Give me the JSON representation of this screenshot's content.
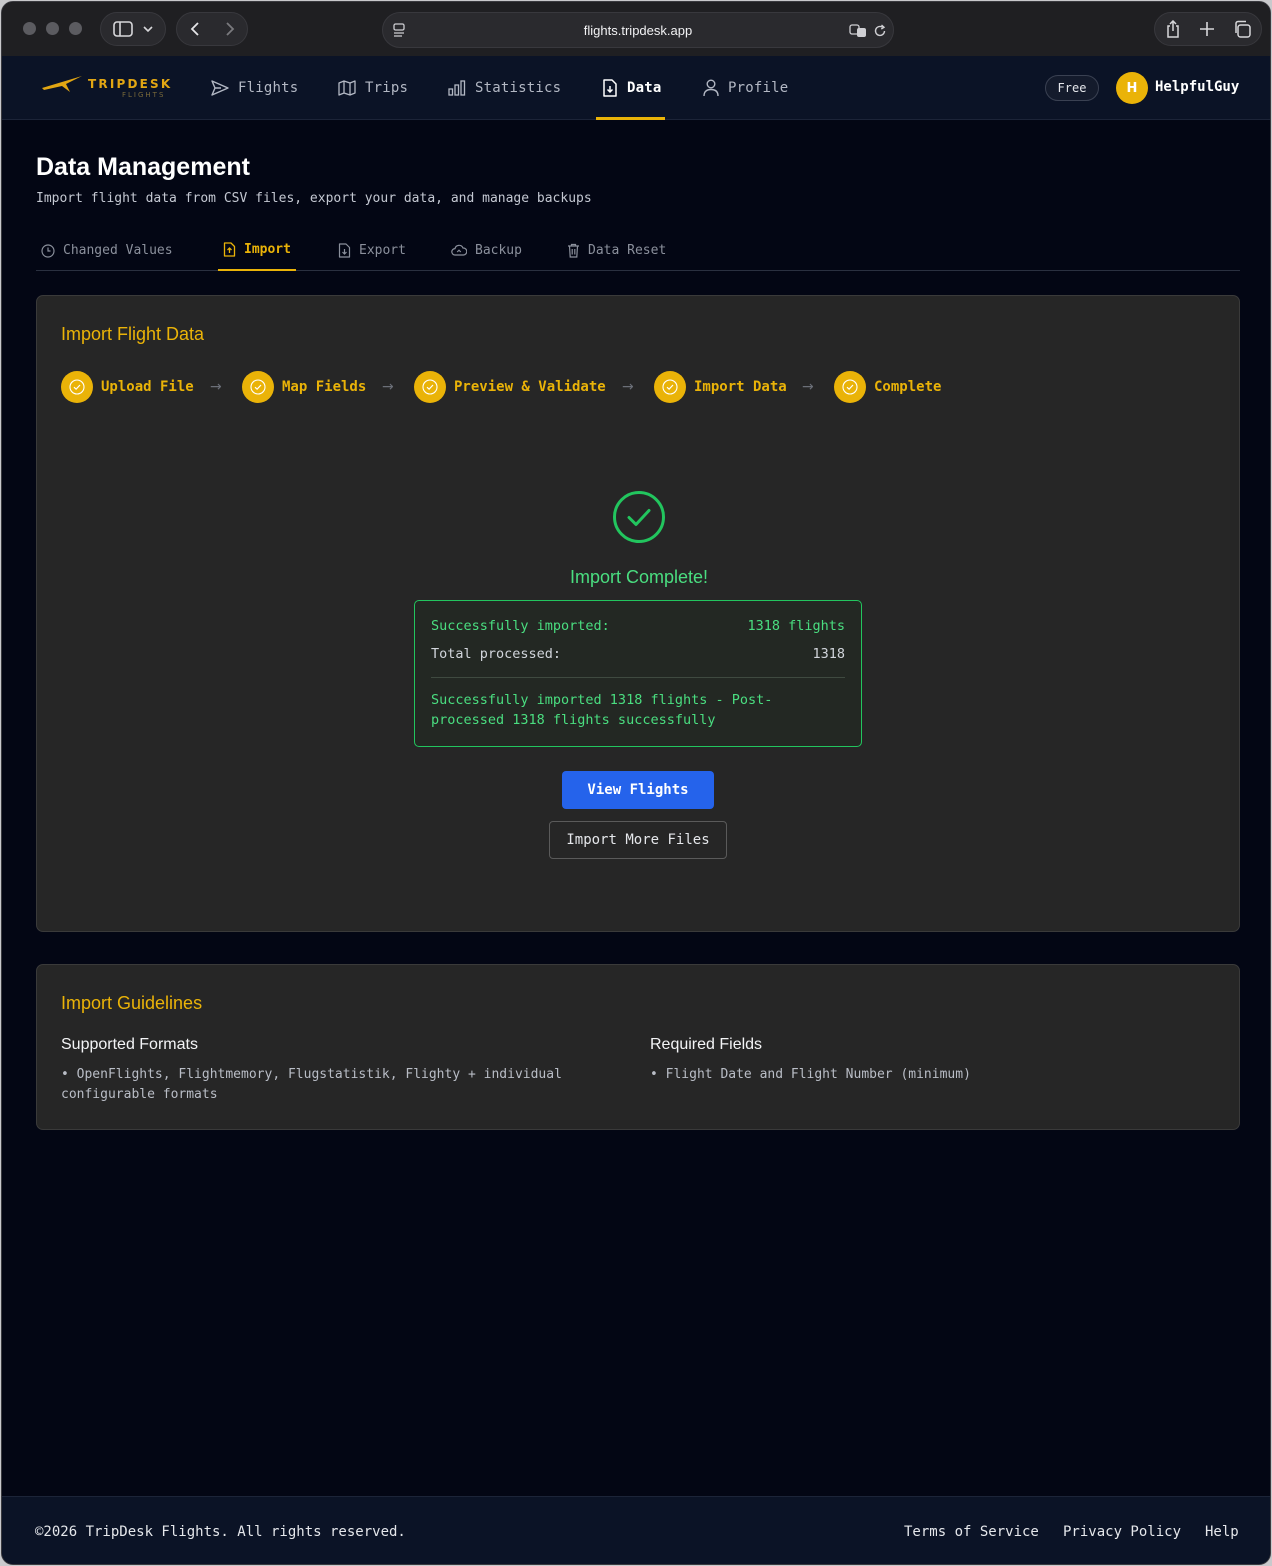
{
  "browser": {
    "url": "flights.tripdesk.app"
  },
  "app": {
    "logo_main": "TRIPDESK",
    "logo_sub": "FLIGHTS",
    "nav": [
      {
        "label": "Flights",
        "icon": "send-icon"
      },
      {
        "label": "Trips",
        "icon": "map-icon"
      },
      {
        "label": "Statistics",
        "icon": "bar-chart-icon"
      },
      {
        "label": "Data",
        "icon": "file-download-icon",
        "active": true
      },
      {
        "label": "Profile",
        "icon": "user-icon"
      }
    ],
    "plan_badge": "Free",
    "avatar_initial": "H",
    "username": "HelpfulGuy",
    "accent_color": "#eab308"
  },
  "page": {
    "title": "Data Management",
    "subtitle": "Import flight data from CSV files, export your data, and manage backups",
    "tabs": [
      {
        "label": "Changed Values",
        "icon": "clock-icon"
      },
      {
        "label": "Import",
        "icon": "file-upload-icon",
        "active": true
      },
      {
        "label": "Export",
        "icon": "file-export-icon"
      },
      {
        "label": "Backup",
        "icon": "cloud-upload-icon"
      },
      {
        "label": "Data Reset",
        "icon": "trash-icon"
      }
    ]
  },
  "import_card": {
    "title": "Import Flight Data",
    "steps": [
      "Upload File",
      "Map Fields",
      "Preview & Validate",
      "Import Data",
      "Complete"
    ],
    "complete_title": "Import Complete!",
    "result": {
      "imported_label": "Successfully imported:",
      "imported_value": "1318 flights",
      "processed_label": "Total processed:",
      "processed_value": "1318",
      "message": "Successfully imported 1318 flights - Post-processed 1318 flights successfully"
    },
    "view_button": "View Flights",
    "import_more_button": "Import More Files",
    "success_color": "#22c55e"
  },
  "guidelines": {
    "title": "Import Guidelines",
    "formats_heading": "Supported Formats",
    "formats_text": "• OpenFlights, Flightmemory, Flugstatistik, Flighty + individual configurable formats",
    "required_heading": "Required Fields",
    "required_text": "• Flight Date and Flight Number (minimum)"
  },
  "footer": {
    "copyright": "©2026 TripDesk Flights. All rights reserved.",
    "links": [
      "Terms of Service",
      "Privacy Policy",
      "Help"
    ]
  }
}
